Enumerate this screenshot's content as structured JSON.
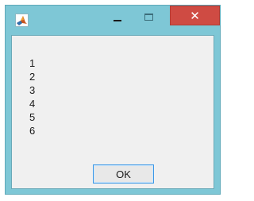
{
  "window": {
    "icon": "matlab-icon",
    "controls": {
      "minimize": "minimize-icon",
      "maximize": "maximize-icon",
      "close": "close-icon",
      "close_glyph": "✕"
    }
  },
  "content": {
    "lines": [
      "1",
      "2",
      "3",
      "4",
      "5",
      "6"
    ]
  },
  "buttons": {
    "ok_label": "OK"
  },
  "colors": {
    "titlebar": "#7ec7d6",
    "close_button": "#cf4b43",
    "client_bg": "#f0f0f0",
    "ok_border": "#3c98e6"
  }
}
